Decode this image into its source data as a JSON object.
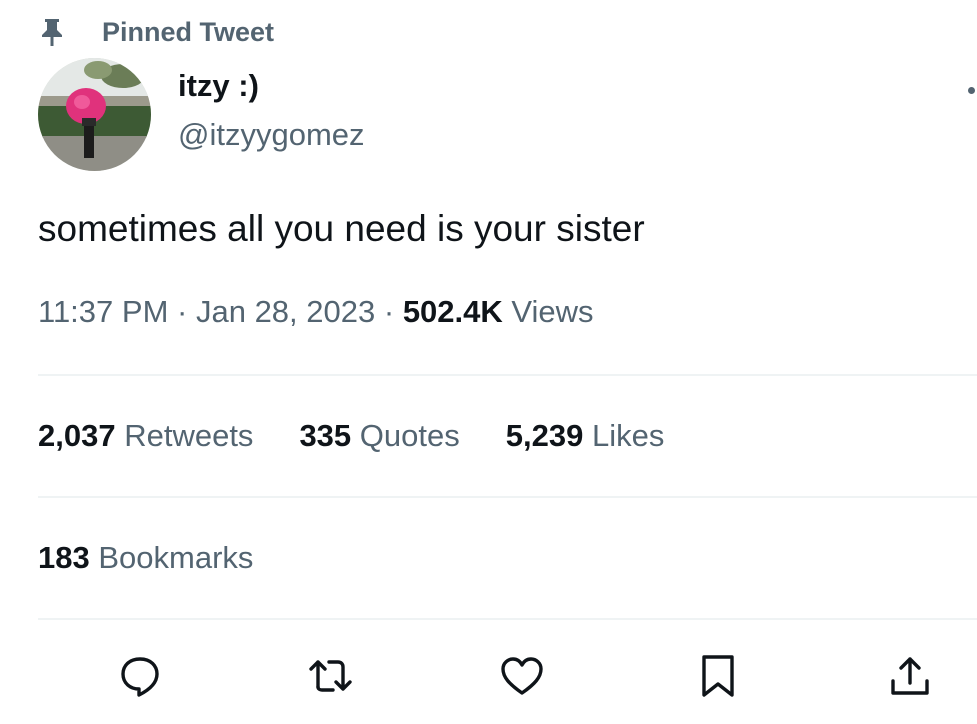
{
  "pinned": {
    "label": "Pinned Tweet",
    "icon": "pin-icon"
  },
  "author": {
    "display_name": "itzy :)",
    "handle": "@itzyygomez"
  },
  "tweet": {
    "text": "sometimes all you need is your sister",
    "time": "11:37 PM",
    "separator": "·",
    "date": "Jan 28, 2023",
    "views_count": "502.4K",
    "views_label": "Views"
  },
  "stats": {
    "retweets_count": "2,037",
    "retweets_label": "Retweets",
    "quotes_count": "335",
    "quotes_label": "Quotes",
    "likes_count": "5,239",
    "likes_label": "Likes",
    "bookmarks_count": "183",
    "bookmarks_label": "Bookmarks"
  },
  "actions": [
    {
      "icon": "reply-icon"
    },
    {
      "icon": "retweet-icon"
    },
    {
      "icon": "like-icon"
    },
    {
      "icon": "bookmark-icon"
    },
    {
      "icon": "share-icon"
    }
  ],
  "colors": {
    "text_primary": "#0f1419",
    "text_secondary": "#536471",
    "divider": "#eff3f4"
  }
}
